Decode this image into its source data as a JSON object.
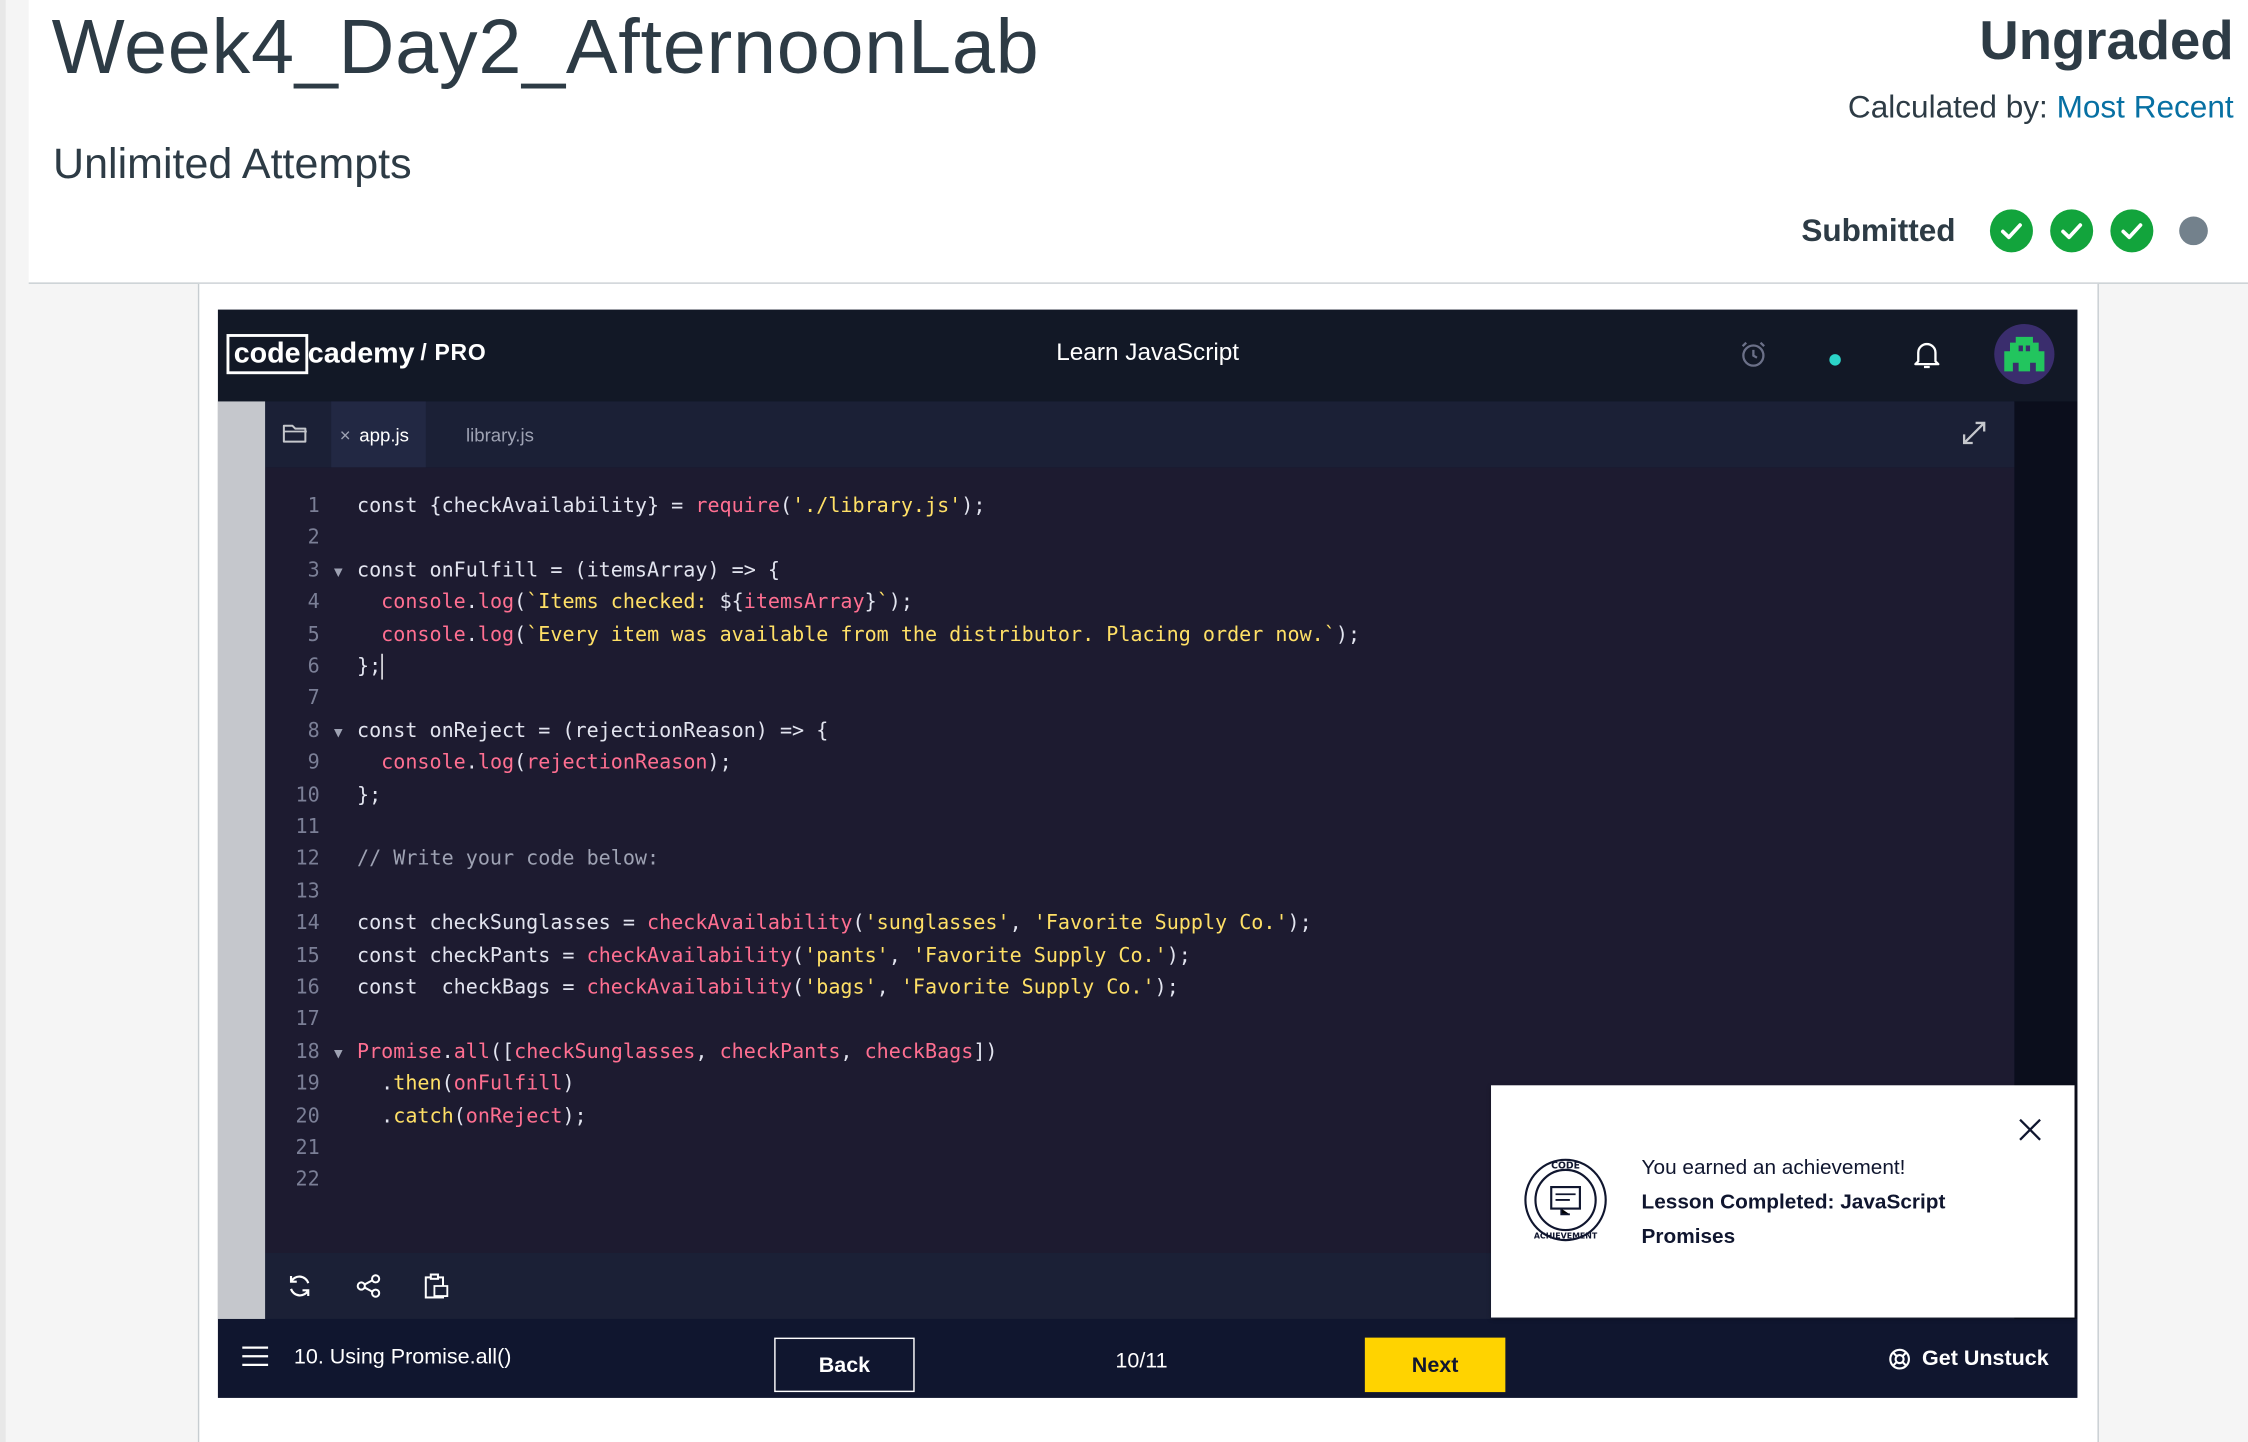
{
  "assignment": {
    "title": "Week4_Day2_AfternoonLab",
    "attempts": "Unlimited Attempts",
    "grade_status": "Ungraded",
    "calculated_by_label": "Calculated by:",
    "calculated_by_value": "Most Recent",
    "submitted_label": "Submitted",
    "attempt_states": [
      "complete",
      "complete",
      "complete",
      "current"
    ]
  },
  "codecademy": {
    "logo_code": "code",
    "logo_cademy": "cademy",
    "logo_pro": "/ PRO",
    "course_title": "Learn JavaScript",
    "tabs": [
      {
        "label": "app.js",
        "active": true
      },
      {
        "label": "library.js",
        "active": false
      }
    ],
    "code_lines": [
      {
        "n": "1",
        "fold": "",
        "html": "<span class='kw'>const</span> {checkAvailability} = <span class='fn'>require</span>(<span class='str'>'./library.js'</span>);"
      },
      {
        "n": "2",
        "fold": "",
        "html": ""
      },
      {
        "n": "3",
        "fold": "▼",
        "html": "<span class='kw'>const</span> onFulfill = (itemsArray) => {"
      },
      {
        "n": "4",
        "fold": "",
        "html": "  <span class='fn'>console</span>.<span class='fn'>log</span>(<span class='str'>`Items checked: </span>${<span class='fn'>itemsArray</span>}<span class='str'>`</span>);"
      },
      {
        "n": "5",
        "fold": "",
        "html": "  <span class='fn'>console</span>.<span class='fn'>log</span>(<span class='str'>`Every item was available from the distributor. Placing order now.`</span>);"
      },
      {
        "n": "6",
        "fold": "",
        "html": "};<span class='caret'></span>"
      },
      {
        "n": "7",
        "fold": "",
        "html": ""
      },
      {
        "n": "8",
        "fold": "▼",
        "html": "<span class='kw'>const</span> onReject = (rejectionReason) => {"
      },
      {
        "n": "9",
        "fold": "",
        "html": "  <span class='fn'>console</span>.<span class='fn'>log</span>(<span class='fn'>rejectionReason</span>);"
      },
      {
        "n": "10",
        "fold": "",
        "html": "};"
      },
      {
        "n": "11",
        "fold": "",
        "html": ""
      },
      {
        "n": "12",
        "fold": "",
        "html": "<span class='cm'>// Write your code below:</span>"
      },
      {
        "n": "13",
        "fold": "",
        "html": ""
      },
      {
        "n": "14",
        "fold": "",
        "html": "<span class='kw'>const</span> checkSunglasses = <span class='fn'>checkAvailability</span>(<span class='str'>'sunglasses'</span>, <span class='str'>'Favorite Supply Co.'</span>);"
      },
      {
        "n": "15",
        "fold": "",
        "html": "<span class='kw'>const</span> checkPants = <span class='fn'>checkAvailability</span>(<span class='str'>'pants'</span>, <span class='str'>'Favorite Supply Co.'</span>);"
      },
      {
        "n": "16",
        "fold": "",
        "html": "<span class='kw'>const</span>  checkBags = <span class='fn'>checkAvailability</span>(<span class='str'>'bags'</span>, <span class='str'>'Favorite Supply Co.'</span>);"
      },
      {
        "n": "17",
        "fold": "",
        "html": ""
      },
      {
        "n": "18",
        "fold": "▼",
        "html": "<span class='fn'>Promise</span>.<span class='fn'>all</span>([<span class='fn'>checkSunglasses</span>, <span class='fn'>checkPants</span>, <span class='fn'>checkBags</span>])"
      },
      {
        "n": "19",
        "fold": "",
        "html": "  .<span class='str'>then</span>(<span class='fn'>onFulfill</span>)"
      },
      {
        "n": "20",
        "fold": "",
        "html": "  .<span class='str'>catch</span>(<span class='fn'>onReject</span>);"
      },
      {
        "n": "21",
        "fold": "",
        "html": ""
      },
      {
        "n": "22",
        "fold": "",
        "html": ""
      }
    ],
    "lesson_label": "10. Using Promise.all()",
    "back_label": "Back",
    "progress": "10/11",
    "next_label": "Next",
    "get_unstuck_label": "Get Unstuck",
    "accent_color": "#ffd300",
    "achievement": {
      "line1": "You earned an achievement!",
      "line2": "Lesson Completed: JavaScript Promises",
      "badge_text": "CODE ACHIEVEMENT"
    }
  }
}
